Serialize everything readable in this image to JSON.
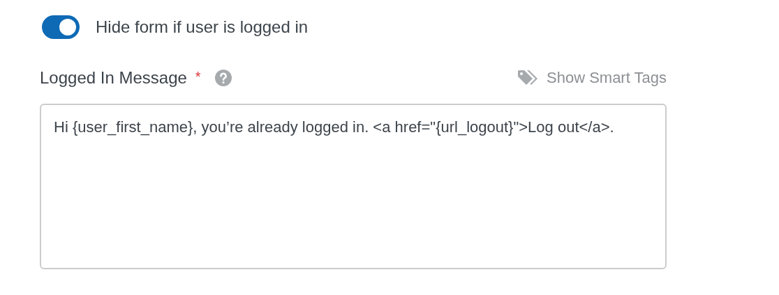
{
  "toggle": {
    "label": "Hide form if user is logged in",
    "on": true
  },
  "message_field": {
    "label": "Logged In Message",
    "required_mark": "*",
    "smart_tags_link": "Show Smart Tags",
    "value": "Hi {user_first_name}, you’re already logged in. <a href=\"{url_logout}\">Log out</a>."
  }
}
